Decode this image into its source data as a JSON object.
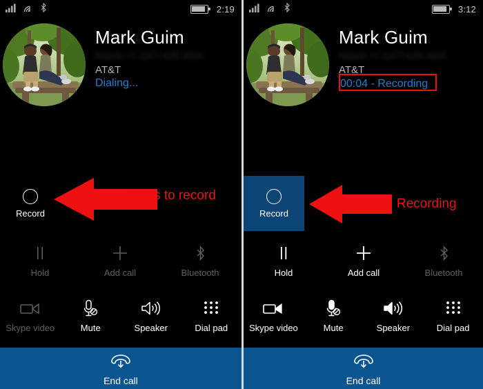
{
  "meta": {
    "accent_blue": "#0a5490",
    "tile_active_blue": "#0b4576",
    "annotation_red": "#ee1111",
    "link_blue": "#1e7fd4",
    "dim_gray": "#5e5e5e"
  },
  "left": {
    "statusbar": {
      "signal_icon": "cellular-signal-icon",
      "wifi_icon": "wifi-icon",
      "bluetooth_icon": "bluetooth-icon",
      "battery_icon": "battery-icon",
      "time": "2:19"
    },
    "contact": {
      "avatar_icon": "contact-avatar-photo",
      "name": "Mark Guim",
      "number": "Mobile +1 (347) 635-4846",
      "carrier": "AT&T",
      "status": "Dialing..."
    },
    "record": {
      "icon": "record-circle-icon",
      "label": "Record",
      "active": false
    },
    "row_three": [
      {
        "icon": "hold-pause-icon",
        "label": "Hold",
        "dim": true
      },
      {
        "icon": "add-call-plus-icon",
        "label": "Add call",
        "dim": true
      },
      {
        "icon": "bluetooth-icon",
        "label": "Bluetooth",
        "dim": true
      }
    ],
    "row_four": [
      {
        "icon": "skype-video-camera-icon",
        "label": "Skype video",
        "dim": true
      },
      {
        "icon": "mute-microphone-icon",
        "label": "Mute",
        "dim": false
      },
      {
        "icon": "speaker-volume-icon",
        "label": "Speaker",
        "dim": false
      },
      {
        "icon": "dial-pad-grid-icon",
        "label": "Dial pad",
        "dim": false
      }
    ],
    "endcall": {
      "icon": "end-call-handset-icon",
      "label": "End call"
    },
    "annotation": {
      "arrow_icon": "left-arrow-annotation",
      "text": "Press to record"
    }
  },
  "right": {
    "statusbar": {
      "signal_icon": "cellular-signal-icon",
      "wifi_icon": "wifi-icon",
      "bluetooth_icon": "bluetooth-icon",
      "battery_icon": "battery-icon",
      "time": "3:12"
    },
    "contact": {
      "avatar_icon": "contact-avatar-photo",
      "name": "Mark Guim",
      "number": "Mobile +1 (347) 635-4846",
      "carrier": "AT&T",
      "status": "00:04 - Recording"
    },
    "record": {
      "icon": "record-circle-icon",
      "label": "Record",
      "active": true
    },
    "row_three": [
      {
        "icon": "hold-pause-icon",
        "label": "Hold",
        "dim": false
      },
      {
        "icon": "add-call-plus-icon",
        "label": "Add call",
        "dim": false
      },
      {
        "icon": "bluetooth-icon",
        "label": "Bluetooth",
        "dim": true
      }
    ],
    "row_four": [
      {
        "icon": "skype-video-camera-icon",
        "label": "Skype video",
        "dim": false
      },
      {
        "icon": "mute-microphone-icon",
        "label": "Mute",
        "dim": false
      },
      {
        "icon": "speaker-volume-icon",
        "label": "Speaker",
        "dim": false
      },
      {
        "icon": "dial-pad-grid-icon",
        "label": "Dial pad",
        "dim": false
      }
    ],
    "endcall": {
      "icon": "end-call-handset-icon",
      "label": "End call"
    },
    "annotation": {
      "arrow_icon": "left-arrow-annotation",
      "text": "Recording"
    }
  }
}
